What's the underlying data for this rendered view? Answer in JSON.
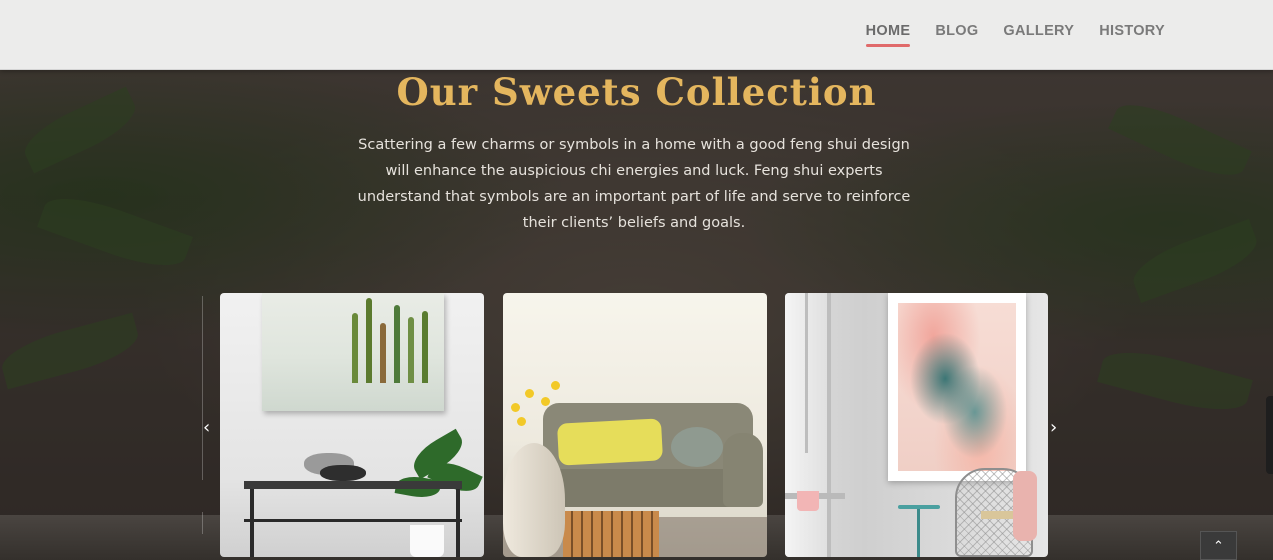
{
  "nav": {
    "items": [
      {
        "label": "HOME",
        "active": true
      },
      {
        "label": "BLOG",
        "active": false
      },
      {
        "label": "GALLERY",
        "active": false
      },
      {
        "label": "HISTORY",
        "active": false
      }
    ]
  },
  "section": {
    "title": "Our Sweets Collection",
    "description": "Scattering a few charms or symbols in a home with a good feng shui design will enhance the auspicious chi energies and luck. Feng shui experts understand that symbols are an important part of life and serve to reinforce their clients’ beliefs and goals."
  },
  "carousel": {
    "prev_icon": "‹",
    "next_icon": "›",
    "slides": [
      {
        "name": "watercolor-landscape-room"
      },
      {
        "name": "sofa-yellow-cushion-room"
      },
      {
        "name": "abstract-art-room"
      }
    ]
  },
  "scroll_top": {
    "icon": "⌃"
  },
  "colors": {
    "accent": "#e06a6a",
    "title_gold": "#e4b65e",
    "header_bg": "#ececeb"
  }
}
